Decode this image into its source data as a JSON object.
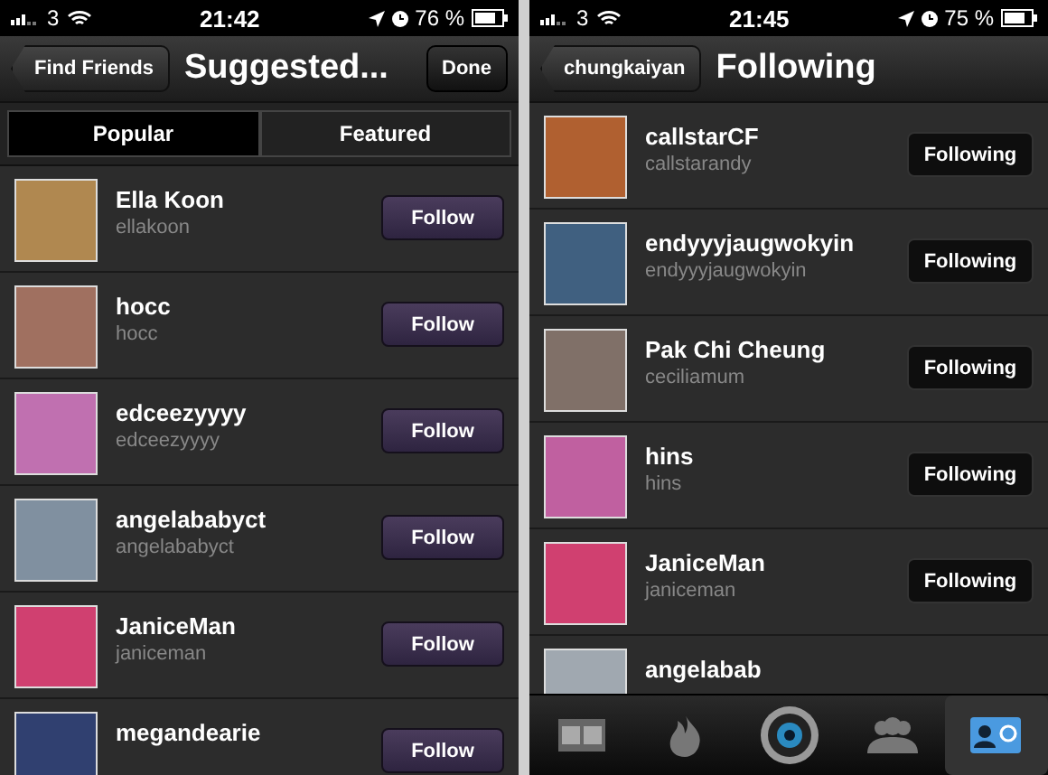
{
  "screens": [
    {
      "status_bar": {
        "carrier": "3",
        "time": "21:42",
        "battery": "76 %"
      },
      "nav": {
        "back": "Find Friends",
        "title": "Suggested...",
        "action": "Done"
      },
      "segments": [
        {
          "label": "Popular",
          "selected": true
        },
        {
          "label": "Featured",
          "selected": false
        }
      ],
      "rows": [
        {
          "name": "Ella Koon",
          "username": "ellakoon",
          "button": "Follow",
          "color": "#b08850"
        },
        {
          "name": "hocc",
          "username": "hocc",
          "button": "Follow",
          "color": "#a07060"
        },
        {
          "name": "edceezyyyy",
          "username": "edceezyyyy",
          "button": "Follow",
          "color": "#c070b0"
        },
        {
          "name": "angelababyct",
          "username": "angelababyct",
          "button": "Follow",
          "color": "#8090a0"
        },
        {
          "name": "JaniceMan",
          "username": "janiceman",
          "button": "Follow",
          "color": "#d04070"
        },
        {
          "name": "megandearie",
          "button": "Follow",
          "color": "#304070"
        }
      ],
      "kind": "suggestions"
    },
    {
      "status_bar": {
        "carrier": "3",
        "time": "21:45",
        "battery": "75 %"
      },
      "nav": {
        "back": "chungkaiyan",
        "title": "Following"
      },
      "rows": [
        {
          "name": "callstarCF",
          "username": "callstarandy",
          "button": "Following",
          "color": "#b06030"
        },
        {
          "name": "endyyyjaugwokyin",
          "username": "endyyyjaugwokyin",
          "button": "Following",
          "color": "#406080"
        },
        {
          "name": "Pak Chi Cheung",
          "username": "ceciliamum",
          "button": "Following",
          "color": "#807068"
        },
        {
          "name": "hins",
          "username": "hins",
          "button": "Following",
          "color": "#c060a0"
        },
        {
          "name": "JaniceMan",
          "username": "janiceman",
          "button": "Following",
          "color": "#d04070"
        },
        {
          "name": "angelabab",
          "color": "#a0a8b0"
        }
      ],
      "kind": "following",
      "tab_bar": [
        {
          "kind": "film",
          "selected": false
        },
        {
          "kind": "flame",
          "selected": false
        },
        {
          "kind": "camera",
          "selected": false
        },
        {
          "kind": "people",
          "selected": false
        },
        {
          "kind": "contact",
          "selected": true
        }
      ]
    }
  ]
}
